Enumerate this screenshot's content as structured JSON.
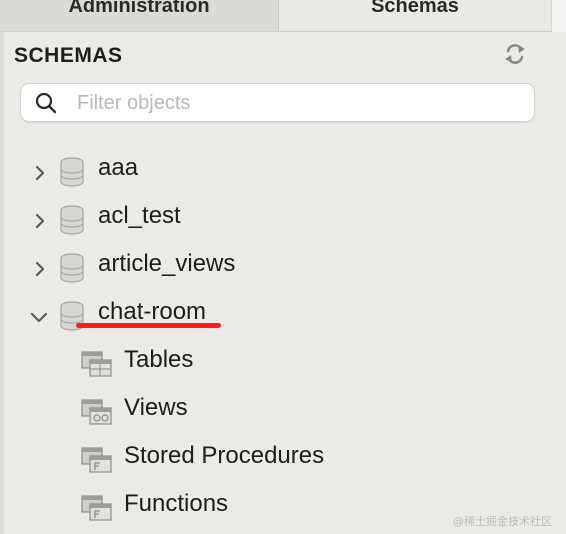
{
  "tabs": [
    {
      "label": "Administration"
    },
    {
      "label": "Schemas"
    }
  ],
  "panel": {
    "title": "SCHEMAS",
    "refresh_icon": "refresh-icon",
    "search": {
      "placeholder": "Filter objects",
      "value": ""
    }
  },
  "schemas": [
    {
      "name": "aaa",
      "expanded": false
    },
    {
      "name": "acl_test",
      "expanded": false
    },
    {
      "name": "article_views",
      "expanded": false
    },
    {
      "name": "chat-room",
      "expanded": true,
      "annotation_color": "#ff1a1a"
    }
  ],
  "chat_room_children": [
    {
      "label": "Tables"
    },
    {
      "label": "Views"
    },
    {
      "label": "Stored Procedures"
    },
    {
      "label": "Functions"
    }
  ],
  "watermark": "@稀土掘金技术社区"
}
